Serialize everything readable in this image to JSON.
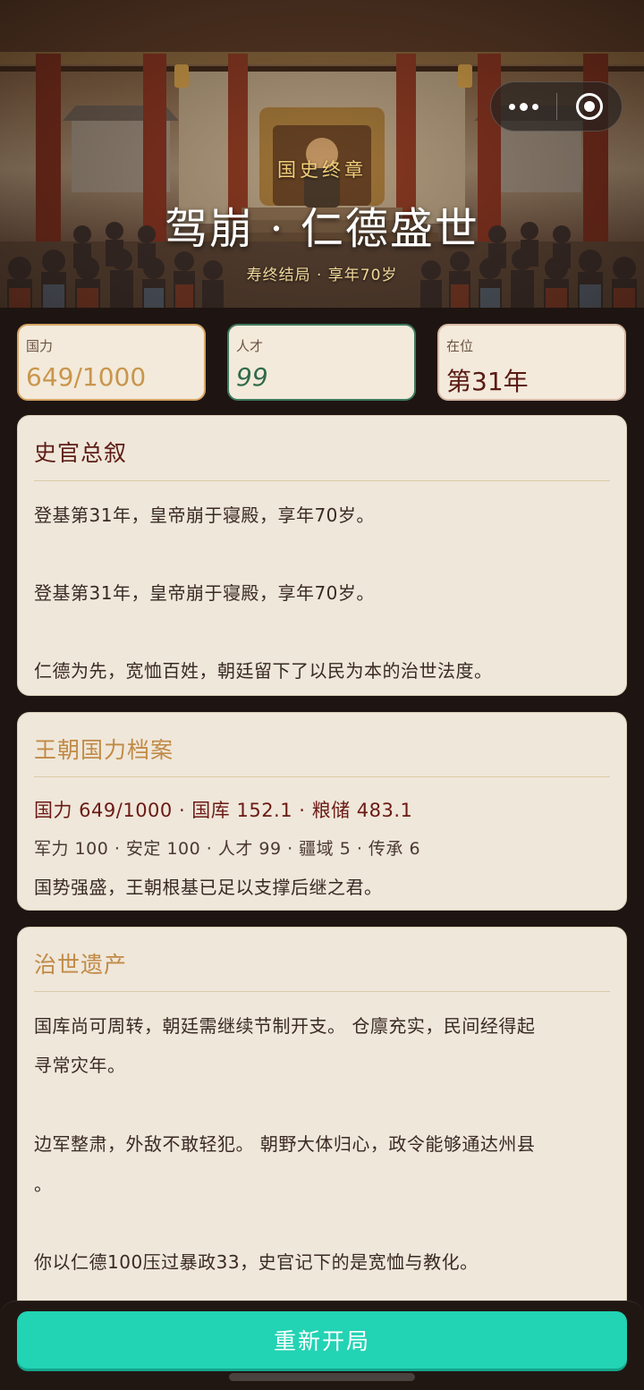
{
  "hero": {
    "kicker": "国史终章",
    "title": "驾崩 · 仁德盛世",
    "subtitle": "寿终结局 · 享年70岁"
  },
  "stats": [
    {
      "label": "国力",
      "value": "649/1000"
    },
    {
      "label": "人才",
      "value": "99"
    },
    {
      "label": "在位",
      "value": "第31年"
    }
  ],
  "chronicle": {
    "title": "史官总叙",
    "paragraphs": [
      "登基第31年，皇帝崩于寝殿，享年70岁。",
      "登基第31年，皇帝崩于寝殿，享年70岁。",
      "仁德为先，宽恤百姓，朝廷留下了以民为本的治世法度。"
    ]
  },
  "archive": {
    "title": "王朝国力档案",
    "line1": "国力 649/1000 · 国库 152.1 · 粮储 483.1",
    "line2": "军力 100 · 安定 100 · 人才 99 · 疆域 5 · 传承 6",
    "line3": "国势强盛，王朝根基已足以支撑后继之君。"
  },
  "legacy": {
    "title": "治世遗产",
    "lines": [
      "国库尚可周转，朝廷需继续节制开支。 仓廪充实，民间经得起",
      "寻常灾年。",
      "边军整肃，外敌不敢轻犯。 朝野大体归心，政令能够通达州县",
      "。",
      "你以仁德100压过暴政33，史官记下的是宽恤与教化。"
    ]
  },
  "actions": {
    "restart_label": "重新开局"
  },
  "icons": {
    "menu": "more-dots-icon",
    "close": "target-close-icon"
  },
  "colors": {
    "accent": "#22d3b4",
    "title_dark": "#5e1d16",
    "title_gold": "#c18a46"
  }
}
